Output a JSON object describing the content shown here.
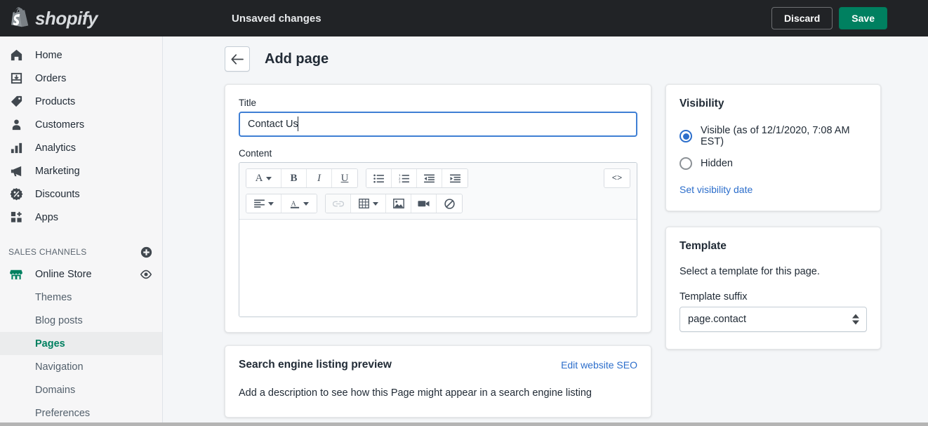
{
  "topbar": {
    "logo_text": "shopify",
    "logo_icon": "shopify-bag-icon",
    "status_text": "Unsaved changes",
    "discard_label": "Discard",
    "save_label": "Save",
    "save_color": "#008060",
    "background": "#212326"
  },
  "sidebar": {
    "items": [
      {
        "label": "Home",
        "icon": "home-icon"
      },
      {
        "label": "Orders",
        "icon": "orders-inbox-icon"
      },
      {
        "label": "Products",
        "icon": "product-tag-icon"
      },
      {
        "label": "Customers",
        "icon": "customer-person-icon"
      },
      {
        "label": "Analytics",
        "icon": "analytics-bars-icon"
      },
      {
        "label": "Marketing",
        "icon": "marketing-megaphone-icon"
      },
      {
        "label": "Discounts",
        "icon": "discount-percent-icon"
      },
      {
        "label": "Apps",
        "icon": "apps-grid-plus-icon"
      }
    ],
    "section": {
      "title": "SALES CHANNELS",
      "add_icon": "plus-circle-icon"
    },
    "channel": {
      "label": "Online Store",
      "icon": "storefront-icon",
      "icon_color": "#008060",
      "view_icon": "eye-icon"
    },
    "sub_items": [
      {
        "label": "Themes",
        "active": false
      },
      {
        "label": "Blog posts",
        "active": false
      },
      {
        "label": "Pages",
        "active": true
      },
      {
        "label": "Navigation",
        "active": false
      },
      {
        "label": "Domains",
        "active": false
      },
      {
        "label": "Preferences",
        "active": false
      }
    ],
    "active_color": "#008060",
    "scrollbar": {
      "up_icon": "scroll-up-arrow-icon"
    }
  },
  "page": {
    "back_icon": "arrow-left-icon",
    "title": "Add page"
  },
  "form": {
    "title_label": "Title",
    "title_value": "Contact Us",
    "title_placeholder": "",
    "content_label": "Content",
    "content_value": ""
  },
  "editor_toolbar": {
    "row1": [
      {
        "name": "format-style-dropdown",
        "glyph": "A",
        "caret": true
      },
      {
        "name": "bold-button",
        "glyph": "B"
      },
      {
        "name": "italic-button",
        "glyph": "I"
      },
      {
        "name": "underline-button",
        "glyph": "U"
      },
      {
        "name": "bulleted-list-button",
        "icon": "bulleted-list-icon"
      },
      {
        "name": "numbered-list-button",
        "icon": "numbered-list-icon"
      },
      {
        "name": "outdent-button",
        "icon": "outdent-icon"
      },
      {
        "name": "indent-button",
        "icon": "indent-icon"
      },
      {
        "name": "show-html-button",
        "glyph": "<>"
      }
    ],
    "row2": [
      {
        "name": "align-dropdown",
        "icon": "align-left-icon",
        "caret": true
      },
      {
        "name": "text-color-dropdown",
        "glyph": "A",
        "caret": true
      },
      {
        "name": "insert-link-button",
        "icon": "link-icon",
        "disabled": true
      },
      {
        "name": "insert-table-dropdown",
        "icon": "table-icon",
        "caret": true
      },
      {
        "name": "insert-image-button",
        "icon": "image-icon"
      },
      {
        "name": "insert-video-button",
        "icon": "video-camera-icon"
      },
      {
        "name": "clear-formatting-button",
        "icon": "no-formatting-icon"
      }
    ],
    "code_label": "<>"
  },
  "visibility": {
    "title": "Visibility",
    "options": [
      {
        "label": "Visible (as of 12/1/2020, 7:08 AM EST)",
        "selected": true
      },
      {
        "label": "Hidden",
        "selected": false
      }
    ],
    "set_date_link": "Set visibility date",
    "accent": "#2c6ecb"
  },
  "template": {
    "title": "Template",
    "description": "Select a template for this page.",
    "suffix_label": "Template suffix",
    "suffix_value": "page.contact"
  },
  "seo": {
    "title": "Search engine listing preview",
    "edit_link": "Edit website SEO",
    "description": "Add a description to see how this Page might appear in a search engine listing"
  }
}
